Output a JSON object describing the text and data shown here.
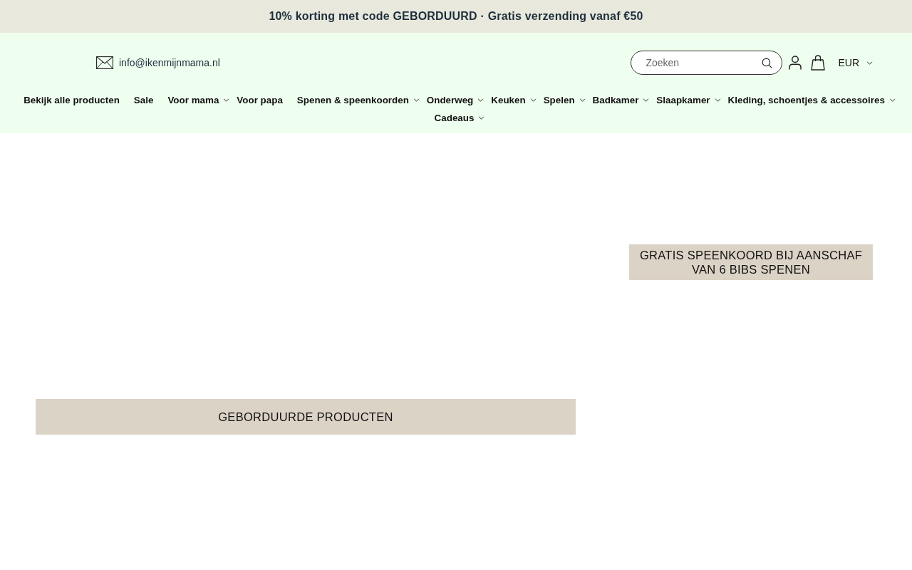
{
  "announcement": {
    "text": "10% korting met code GEBORDUURD · Gratis verzending vanaf €50"
  },
  "header": {
    "email": "info@ikenmijnmama.nl",
    "search": {
      "placeholder": "Zoeken"
    },
    "currency": "EUR"
  },
  "nav": [
    {
      "label": "Bekijk alle producten",
      "dropdown": false
    },
    {
      "label": "Sale",
      "dropdown": false
    },
    {
      "label": "Voor mama",
      "dropdown": true
    },
    {
      "label": "Voor papa",
      "dropdown": false
    },
    {
      "label": "Spenen & speenkoorden",
      "dropdown": true
    },
    {
      "label": "Onderweg",
      "dropdown": true
    },
    {
      "label": "Keuken",
      "dropdown": true
    },
    {
      "label": "Spelen",
      "dropdown": true
    },
    {
      "label": "Badkamer",
      "dropdown": true
    },
    {
      "label": "Slaapkamer",
      "dropdown": true
    },
    {
      "label": "Kleding, schoentjes & accessoires",
      "dropdown": true
    },
    {
      "label": "Cadeaus",
      "dropdown": true
    }
  ],
  "promos": [
    {
      "text": "GEBORDUURDE PRODUCTEN"
    },
    {
      "text": "GRATIS SPEENKOORD BIJ AANSCHAF VAN 6 BIBS SPENEN"
    }
  ]
}
